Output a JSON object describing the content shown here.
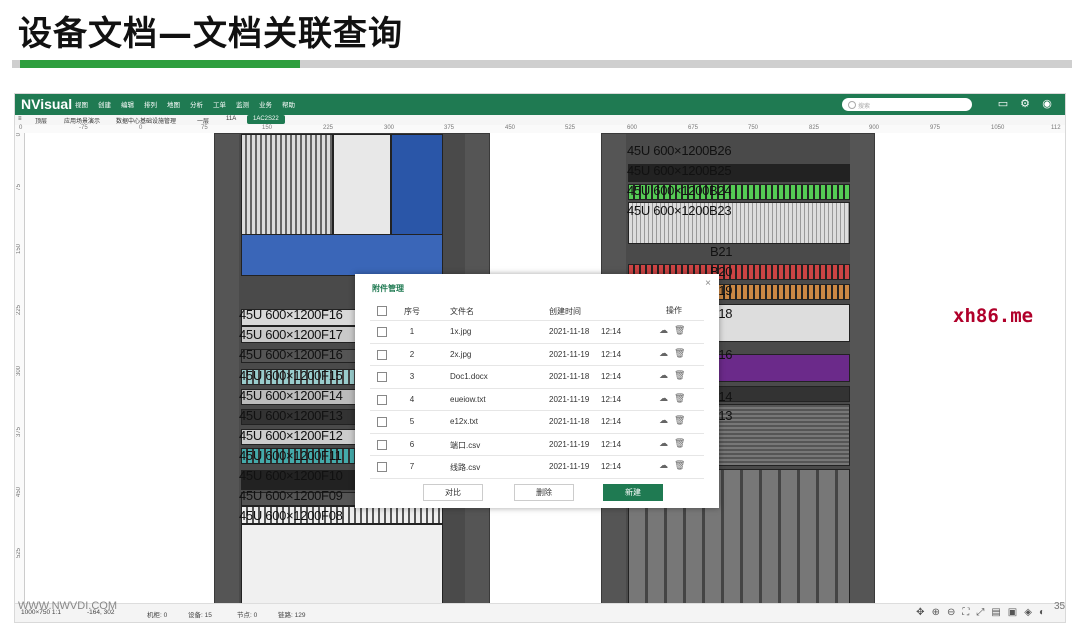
{
  "slide": {
    "title": "设备文档—文档关联查询",
    "brand": "xh86.me",
    "watermark": "WWW.NWVDI.COM",
    "page_number": "35"
  },
  "app": {
    "logo": "NVisual",
    "menu": [
      "视图",
      "创建",
      "编辑",
      "排列",
      "地图",
      "分析",
      "工单",
      "监测",
      "业务",
      "帮助"
    ],
    "search_placeholder": "搜索",
    "breadcrumbs": [
      "顶层",
      "应用场景演示",
      "数据中心基础设施管理",
      "一层",
      "11A",
      "1AC2S22"
    ],
    "ruler_top": [
      "0",
      "-75",
      "0",
      "75",
      "150",
      "225",
      "300",
      "375",
      "450",
      "525",
      "600",
      "675",
      "750",
      "825",
      "900",
      "975",
      "1050",
      "112"
    ],
    "ruler_left": [
      "0",
      "75",
      "150",
      "225",
      "300",
      "375",
      "450",
      "525"
    ],
    "rack_labels_left": [
      "45U 600×1200F16",
      "45U 600×1200F17",
      "45U 600×1200F16",
      "45U 600×1200F15",
      "45U 600×1200F14",
      "45U 600×1200F13",
      "45U 600×1200F12",
      "45U 600×1200F11",
      "45U 600×1200F10",
      "45U 600×1200F09",
      "45U 600×1200F08"
    ],
    "rack_labels_right": [
      "45U 600×1200B26",
      "45U 600×1200B25",
      "45U 600×1200B24",
      "45U 600×1200B23",
      "B21",
      "B20",
      "B19",
      "B18",
      "B16",
      "B14",
      "B13"
    ],
    "status": {
      "zoom": "1000×750  1:1",
      "coords": "-164, 302",
      "cabinets": "机柜: 0",
      "devices": "设备: 15",
      "nodes": "节点: 0",
      "links": "链路: 129"
    },
    "status_tools": [
      "move-icon",
      "zoom-in-icon",
      "zoom-out-icon",
      "fit-icon",
      "fullscreen-icon",
      "doc-icon",
      "panel-icon",
      "layers-icon",
      "theme-icon"
    ]
  },
  "dialog": {
    "title": "附件管理",
    "close": "×",
    "headers": {
      "no": "序号",
      "name": "文件名",
      "created": "创建时间",
      "ops": "操作"
    },
    "rows": [
      {
        "no": "1",
        "name": "1x.jpg",
        "date": "2021-11-18",
        "time": "12:14"
      },
      {
        "no": "2",
        "name": "2x.jpg",
        "date": "2021-11-19",
        "time": "12:14"
      },
      {
        "no": "3",
        "name": "Doc1.docx",
        "date": "2021-11-18",
        "time": "12:14"
      },
      {
        "no": "4",
        "name": "eueiow.txt",
        "date": "2021-11-19",
        "time": "12:14"
      },
      {
        "no": "5",
        "name": "e12x.txt",
        "date": "2021-11-18",
        "time": "12:14"
      },
      {
        "no": "6",
        "name": "端口.csv",
        "date": "2021-11-19",
        "time": "12:14"
      },
      {
        "no": "7",
        "name": "线路.csv",
        "date": "2021-11-19",
        "time": "12:14"
      }
    ],
    "buttons": {
      "compare": "对比",
      "delete": "删除",
      "create": "新建"
    }
  },
  "colors": {
    "brand_green": "#1f7a52",
    "accent_green": "#2e9e3e",
    "brand_red": "#b0002a"
  }
}
